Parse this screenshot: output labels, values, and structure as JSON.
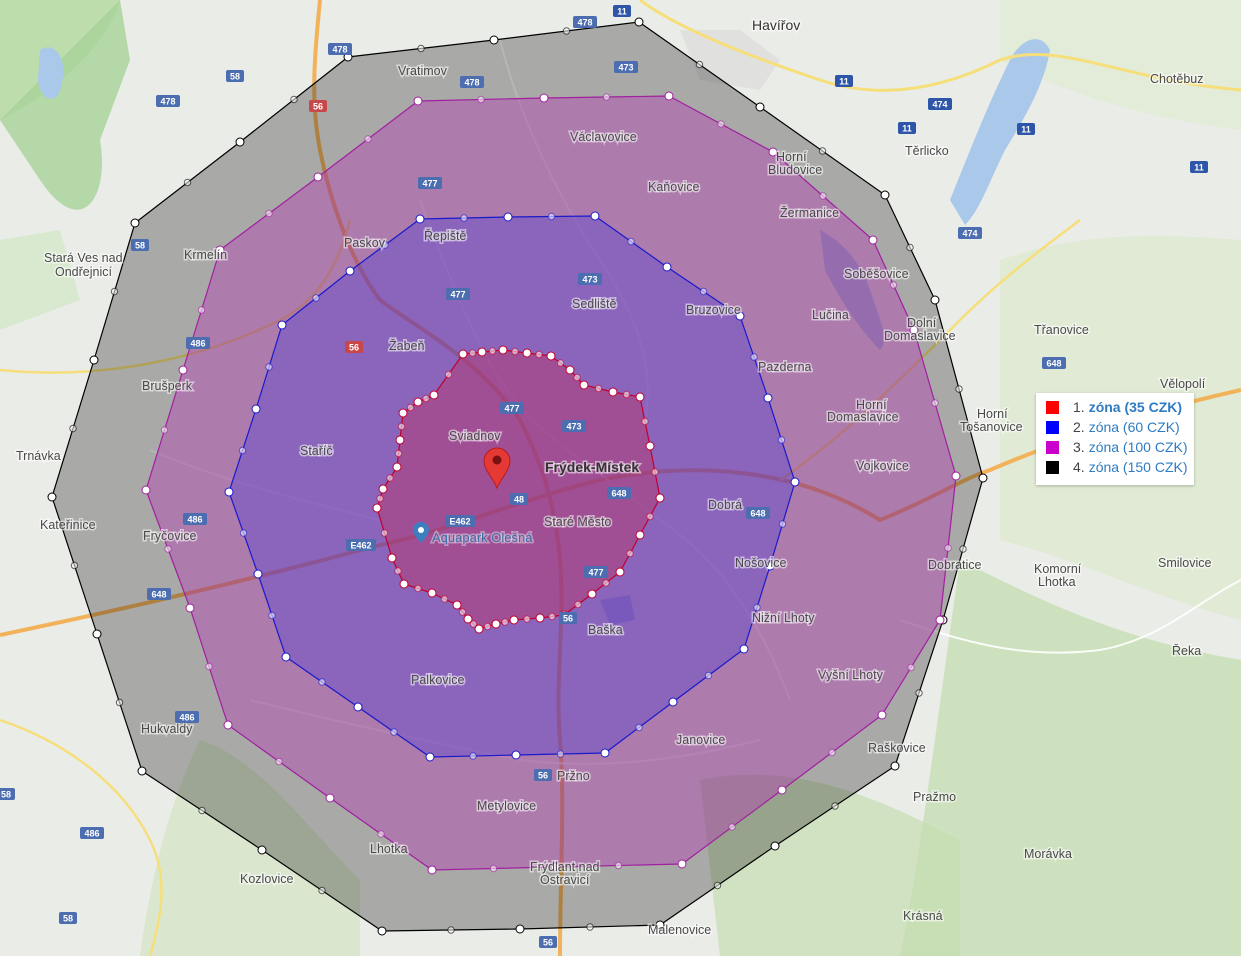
{
  "places": [
    {
      "id": "havirov",
      "label": "Havířov",
      "cls": "city"
    },
    {
      "id": "vratimov",
      "label": "Vratimov"
    },
    {
      "id": "vaclavovice",
      "label": "Václavovice"
    },
    {
      "id": "horni-bludovice-1",
      "label": "Horní"
    },
    {
      "id": "horni-bludovice-2",
      "label": "Bludovice"
    },
    {
      "id": "chotebuz",
      "label": "Chotěbuz"
    },
    {
      "id": "terlicko",
      "label": "Těrlicko"
    },
    {
      "id": "kanovice",
      "label": "Kaňovice"
    },
    {
      "id": "zermanice",
      "label": "Žermanice"
    },
    {
      "id": "repiste",
      "label": "Řepiště"
    },
    {
      "id": "paskov",
      "label": "Paskov"
    },
    {
      "id": "stara-ves-1",
      "label": "Stará Ves nad"
    },
    {
      "id": "stara-ves-2",
      "label": "Ondřejnicí"
    },
    {
      "id": "krmelin",
      "label": "Krmelín"
    },
    {
      "id": "sedliste",
      "label": "Sedliště"
    },
    {
      "id": "sobesovice",
      "label": "Soběšovice"
    },
    {
      "id": "bruzovice",
      "label": "Bruzovice"
    },
    {
      "id": "lucina",
      "label": "Lučina"
    },
    {
      "id": "dolni-domaslavice-1",
      "label": "Dolní"
    },
    {
      "id": "dolni-domaslavice-2",
      "label": "Domaslavice"
    },
    {
      "id": "tranovice",
      "label": "Třanovice"
    },
    {
      "id": "zaben",
      "label": "Žabeň"
    },
    {
      "id": "pazderna",
      "label": "Pazderna"
    },
    {
      "id": "brusperk",
      "label": "Brušperk"
    },
    {
      "id": "velopoli",
      "label": "Vělopolí"
    },
    {
      "id": "horni-domaslavice-1",
      "label": "Horní"
    },
    {
      "id": "horni-domaslavice-2",
      "label": "Domaslavice"
    },
    {
      "id": "horni-tosanovice-1",
      "label": "Horní"
    },
    {
      "id": "horni-tosanovice-2",
      "label": "Tošanovice"
    },
    {
      "id": "sviadnov",
      "label": "Sviadnov"
    },
    {
      "id": "starric",
      "label": "Staříč"
    },
    {
      "id": "trnavka",
      "label": "Trnávka"
    },
    {
      "id": "frydek-mistek",
      "label": "Frýdek-Místek",
      "cls": "big"
    },
    {
      "id": "vojkovice",
      "label": "Vojkovice"
    },
    {
      "id": "dobra",
      "label": "Dobrá"
    },
    {
      "id": "katerinice",
      "label": "Kateřinice"
    },
    {
      "id": "stare-mesto",
      "label": "Staré Město"
    },
    {
      "id": "frycovice",
      "label": "Fryčovice"
    },
    {
      "id": "nosovice",
      "label": "Nošovice"
    },
    {
      "id": "dobratice",
      "label": "Dobratice"
    },
    {
      "id": "komorni-lhotka-1",
      "label": "Komorní"
    },
    {
      "id": "komorni-lhotka-2",
      "label": "Lhotka"
    },
    {
      "id": "smilovice",
      "label": "Smilovice"
    },
    {
      "id": "baska",
      "label": "Baška"
    },
    {
      "id": "nizni-lhoty",
      "label": "Nižní Lhoty"
    },
    {
      "id": "reka",
      "label": "Řeka"
    },
    {
      "id": "palkovice",
      "label": "Palkovice"
    },
    {
      "id": "vysni-lhoty",
      "label": "Vyšní Lhoty"
    },
    {
      "id": "hukvaldy",
      "label": "Hukvaldy"
    },
    {
      "id": "janovice",
      "label": "Janovice"
    },
    {
      "id": "raskovice",
      "label": "Raškovice"
    },
    {
      "id": "przno",
      "label": "Pržno"
    },
    {
      "id": "prazmo",
      "label": "Pražmo"
    },
    {
      "id": "metylovice",
      "label": "Metylovice"
    },
    {
      "id": "lhotka",
      "label": "Lhotka"
    },
    {
      "id": "moravka",
      "label": "Morávka"
    },
    {
      "id": "frydlant-1",
      "label": "Frýdlant nad"
    },
    {
      "id": "frydlant-2",
      "label": "Ostravicí"
    },
    {
      "id": "kozlovice",
      "label": "Kozlovice"
    },
    {
      "id": "krasna",
      "label": "Krásná"
    },
    {
      "id": "malenovice",
      "label": "Malenovice"
    }
  ],
  "poi": {
    "label": "Aquapark Olešná"
  },
  "shields": [
    {
      "id": "s478a",
      "label": "478"
    },
    {
      "id": "s11a",
      "label": "11"
    },
    {
      "id": "s478b",
      "label": "478"
    },
    {
      "id": "s473a",
      "label": "473"
    },
    {
      "id": "s58a",
      "label": "58"
    },
    {
      "id": "s478c",
      "label": "478"
    },
    {
      "id": "s478d",
      "label": "478"
    },
    {
      "id": "s56a",
      "label": "56"
    },
    {
      "id": "s11b",
      "label": "11"
    },
    {
      "id": "s474a",
      "label": "474"
    },
    {
      "id": "s11c",
      "label": "11"
    },
    {
      "id": "s11d",
      "label": "11"
    },
    {
      "id": "s11e",
      "label": "11"
    },
    {
      "id": "s477a",
      "label": "477"
    },
    {
      "id": "s58b",
      "label": "58"
    },
    {
      "id": "s473b",
      "label": "473"
    },
    {
      "id": "s477b",
      "label": "477"
    },
    {
      "id": "s474b",
      "label": "474"
    },
    {
      "id": "s486a",
      "label": "486"
    },
    {
      "id": "s56b",
      "label": "56"
    },
    {
      "id": "s648a",
      "label": "648"
    },
    {
      "id": "s477c",
      "label": "477"
    },
    {
      "id": "s473c",
      "label": "473"
    },
    {
      "id": "s648b",
      "label": "648"
    },
    {
      "id": "s48",
      "label": "48"
    },
    {
      "id": "sE462a",
      "label": "E462"
    },
    {
      "id": "sE462b",
      "label": "E462"
    },
    {
      "id": "s648c",
      "label": "648"
    },
    {
      "id": "s486b",
      "label": "486"
    },
    {
      "id": "s648d",
      "label": "648"
    },
    {
      "id": "s477d",
      "label": "477"
    },
    {
      "id": "s56c",
      "label": "56"
    },
    {
      "id": "s486c",
      "label": "486"
    },
    {
      "id": "s58c",
      "label": "58"
    },
    {
      "id": "s56d",
      "label": "56"
    },
    {
      "id": "s486d",
      "label": "486"
    },
    {
      "id": "s58d",
      "label": "58"
    },
    {
      "id": "s56e",
      "label": "56"
    }
  ],
  "zones": [
    {
      "name": "zone-4",
      "fill": "#000000",
      "fill_opacity": 0.28,
      "stroke": "#000000"
    },
    {
      "name": "zone-3",
      "fill": "#b43cb4",
      "fill_opacity": 0.42,
      "stroke": "#a020a0"
    },
    {
      "name": "zone-2",
      "fill": "#4a3ad8",
      "fill_opacity": 0.35,
      "stroke": "#1a1acc"
    },
    {
      "name": "zone-1",
      "fill": "#c0305a",
      "fill_opacity": 0.4,
      "stroke": "#c00030"
    }
  ],
  "legend": [
    {
      "num": "1.",
      "label": "zóna (35 CZK)",
      "color": "#ff0000",
      "active": true
    },
    {
      "num": "2.",
      "label": "zóna (60 CZK)",
      "color": "#0000ff",
      "active": false
    },
    {
      "num": "3.",
      "label": "zóna (100 CZK)",
      "color": "#cc00cc",
      "active": false
    },
    {
      "num": "4.",
      "label": "zóna (150 CZK)",
      "color": "#000000",
      "active": false
    }
  ],
  "colors": {
    "marker": "#e53935",
    "marker_dot": "#7a1010",
    "map_bg": "#e8eae6",
    "green": "#b6d9a6",
    "water": "#a9c8ea",
    "road_orange": "#f2b25a",
    "road_yellow": "#f6df7a"
  }
}
